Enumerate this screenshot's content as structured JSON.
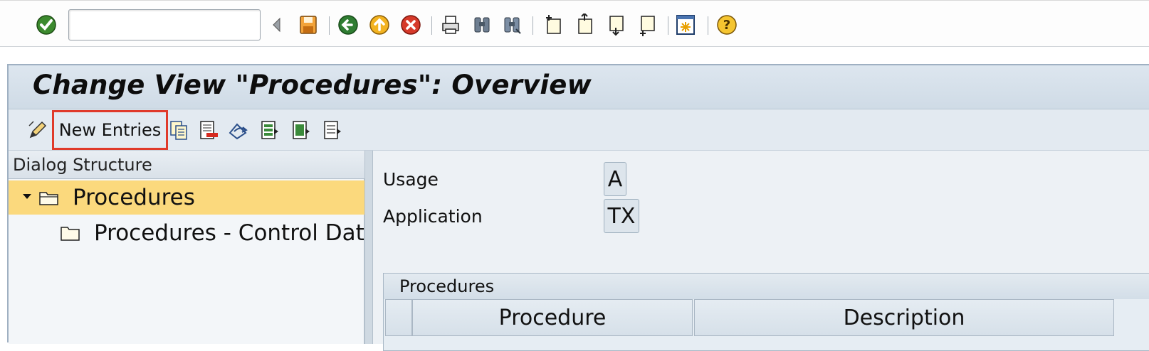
{
  "system_toolbar": {
    "command_field_value": "",
    "icons": [
      "enter-icon",
      "back-arrow-small-icon",
      "save-icon",
      "back-icon",
      "exit-icon",
      "cancel-icon",
      "print-icon",
      "find-icon",
      "find-next-icon",
      "first-page-icon",
      "previous-page-icon",
      "next-page-icon",
      "last-page-icon",
      "layout-icon",
      "help-icon"
    ]
  },
  "title": "Change View \"Procedures\": Overview",
  "app_toolbar": {
    "new_entries_label": "New Entries"
  },
  "dialog_structure": {
    "header": "Dialog Structure",
    "items": [
      {
        "label": "Procedures",
        "expanded": true,
        "selected": true
      },
      {
        "label": "Procedures - Control Dat",
        "expanded": false,
        "selected": false
      }
    ]
  },
  "fields": {
    "usage_label": "Usage",
    "usage_value": "A",
    "application_label": "Application",
    "application_value": "TX"
  },
  "procedures_table": {
    "title": "Procedures",
    "columns": [
      "Procedure",
      "Description"
    ]
  },
  "colors": {
    "selection": "#fbd97d",
    "highlight_box": "#e03a2a",
    "frame_background": "#dfe6ed"
  }
}
